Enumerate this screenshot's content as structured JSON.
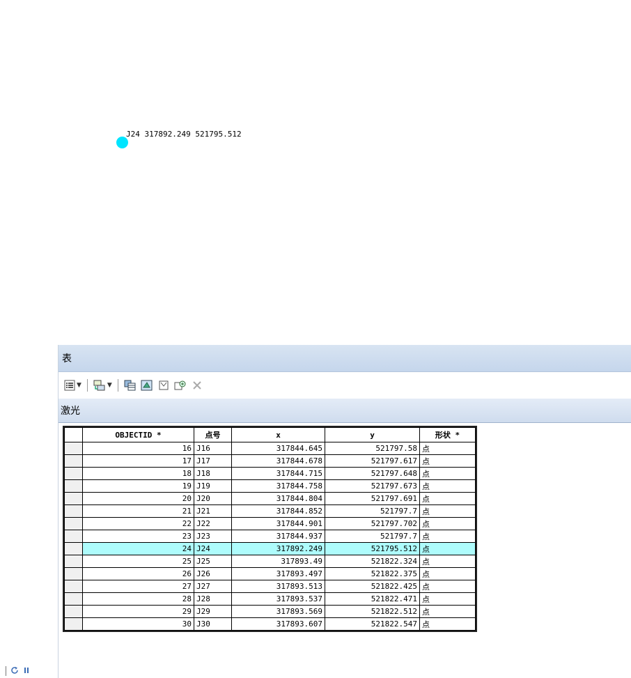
{
  "map": {
    "point_label": "J24 317892.249 521795.512",
    "point_color": "#00e5ff"
  },
  "window": {
    "title": "表",
    "layer_tab": "激光"
  },
  "toolbar": {
    "icons": [
      "table-options-icon",
      "related-tables-icon",
      "select-by-attributes-icon",
      "switch-selection-icon",
      "clear-selection-icon",
      "zoom-to-selected-icon",
      "delete-selected-icon"
    ]
  },
  "table": {
    "headers": [
      "OBJECTID *",
      "点号",
      "x",
      "y",
      "形状 *"
    ],
    "highlight_color": "#aefcfc",
    "rows": [
      {
        "id": "16",
        "pt": "J16",
        "x": "317844.645",
        "y": "521797.58",
        "shape": "点"
      },
      {
        "id": "17",
        "pt": "J17",
        "x": "317844.678",
        "y": "521797.617",
        "shape": "点"
      },
      {
        "id": "18",
        "pt": "J18",
        "x": "317844.715",
        "y": "521797.648",
        "shape": "点"
      },
      {
        "id": "19",
        "pt": "J19",
        "x": "317844.758",
        "y": "521797.673",
        "shape": "点"
      },
      {
        "id": "20",
        "pt": "J20",
        "x": "317844.804",
        "y": "521797.691",
        "shape": "点"
      },
      {
        "id": "21",
        "pt": "J21",
        "x": "317844.852",
        "y": "521797.7",
        "shape": "点"
      },
      {
        "id": "22",
        "pt": "J22",
        "x": "317844.901",
        "y": "521797.702",
        "shape": "点"
      },
      {
        "id": "23",
        "pt": "J23",
        "x": "317844.937",
        "y": "521797.7",
        "shape": "点"
      },
      {
        "id": "24",
        "pt": "J24",
        "x": "317892.249",
        "y": "521795.512",
        "shape": "点",
        "selected": true
      },
      {
        "id": "25",
        "pt": "J25",
        "x": "317893.49",
        "y": "521822.324",
        "shape": "点"
      },
      {
        "id": "26",
        "pt": "J26",
        "x": "317893.497",
        "y": "521822.375",
        "shape": "点"
      },
      {
        "id": "27",
        "pt": "J27",
        "x": "317893.513",
        "y": "521822.425",
        "shape": "点"
      },
      {
        "id": "28",
        "pt": "J28",
        "x": "317893.537",
        "y": "521822.471",
        "shape": "点"
      },
      {
        "id": "29",
        "pt": "J29",
        "x": "317893.569",
        "y": "521822.512",
        "shape": "点"
      },
      {
        "id": "30",
        "pt": "J30",
        "x": "317893.607",
        "y": "521822.547",
        "shape": "点"
      }
    ]
  },
  "status": {
    "icons": [
      "refresh-icon",
      "pause-icon"
    ]
  }
}
